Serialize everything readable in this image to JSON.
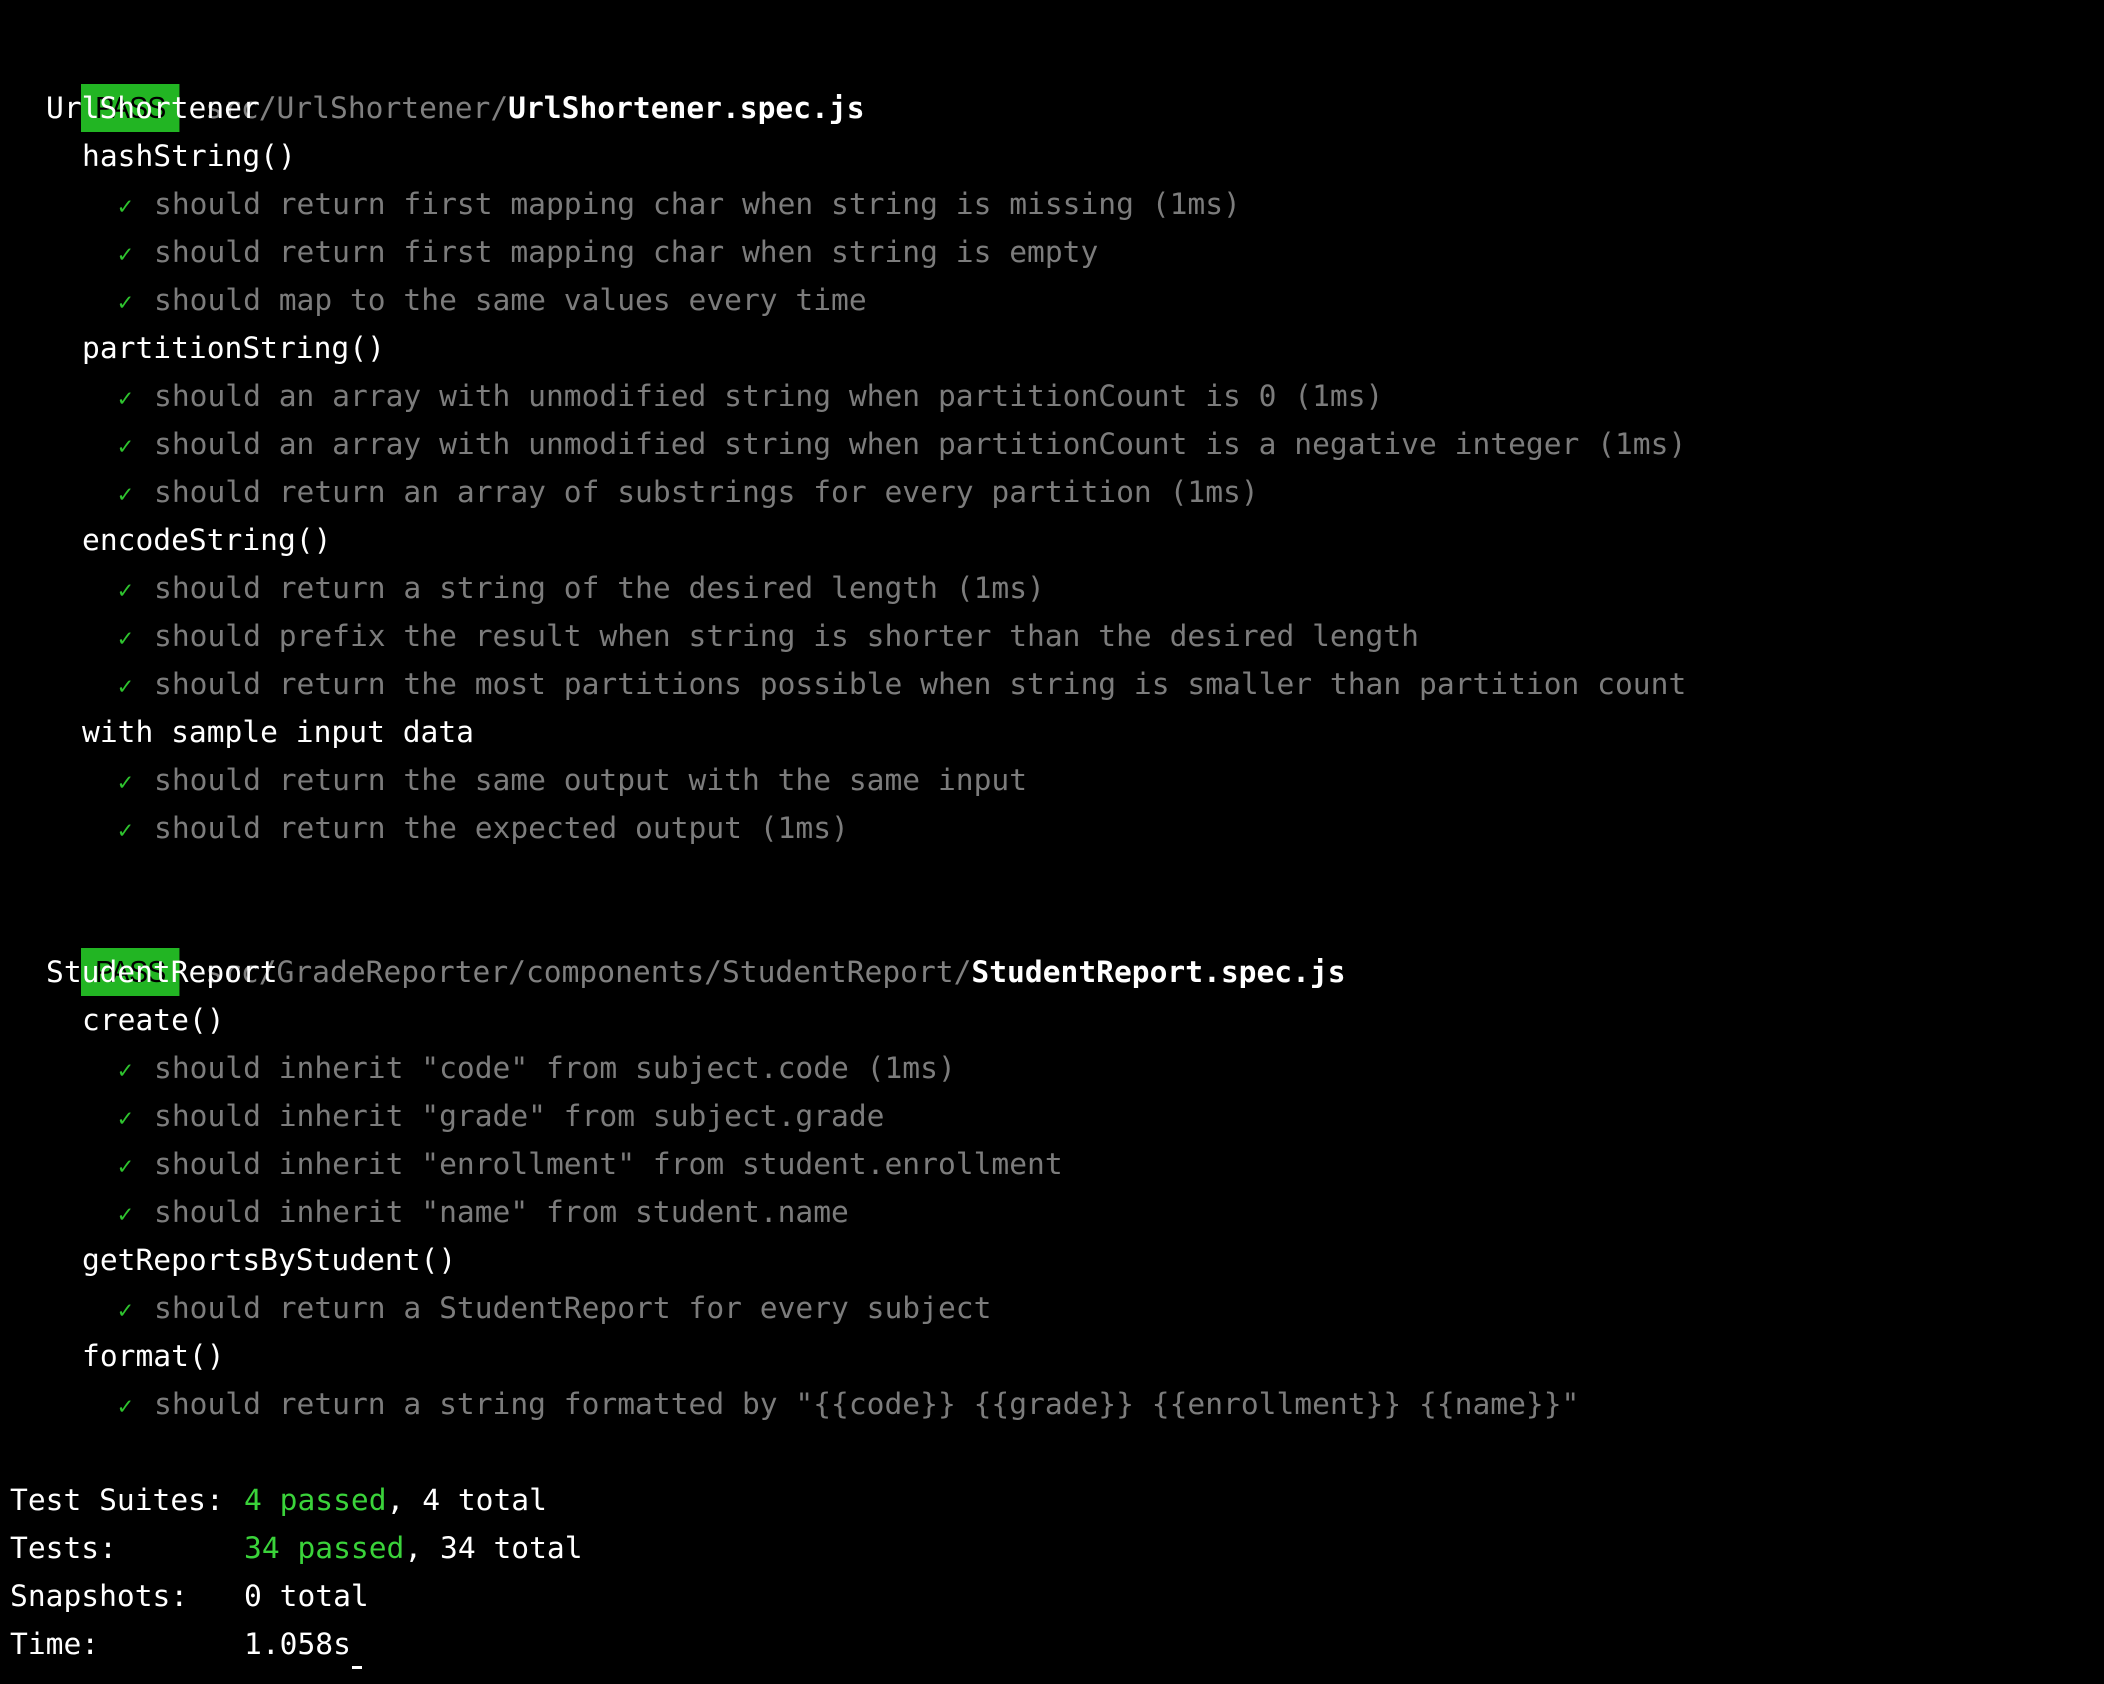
{
  "colors": {
    "background": "#000000",
    "pass_badge": "#22b523",
    "check": "#2ec32e",
    "passed_text": "#3ad33a",
    "path_gray": "#808080",
    "test_gray": "#7c7c7c"
  },
  "suites": [
    {
      "status": "PASS",
      "path": "src/UrlShortener/",
      "file": "UrlShortener.spec.js",
      "describe": "UrlShortener",
      "groups": [
        {
          "name": "hashString()",
          "tests": [
            {
              "icon": "check-icon",
              "glyph": "✓",
              "title": "should return first mapping char when string is missing (1ms)"
            },
            {
              "icon": "check-icon",
              "glyph": "✓",
              "title": "should return first mapping char when string is empty"
            },
            {
              "icon": "check-icon",
              "glyph": "✓",
              "title": "should map to the same values every time"
            }
          ]
        },
        {
          "name": "partitionString()",
          "tests": [
            {
              "icon": "check-icon",
              "glyph": "✓",
              "title": "should an array with unmodified string when partitionCount is 0 (1ms)"
            },
            {
              "icon": "check-icon",
              "glyph": "✓",
              "title": "should an array with unmodified string when partitionCount is a negative integer (1ms)"
            },
            {
              "icon": "check-icon",
              "glyph": "✓",
              "title": "should return an array of substrings for every partition (1ms)"
            }
          ]
        },
        {
          "name": "encodeString()",
          "tests": [
            {
              "icon": "check-icon",
              "glyph": "✓",
              "title": "should return a string of the desired length (1ms)"
            },
            {
              "icon": "check-icon",
              "glyph": "✓",
              "title": "should prefix the result when string is shorter than the desired length"
            },
            {
              "icon": "check-icon",
              "glyph": "✓",
              "title": "should return the most partitions possible when string is smaller than partition count"
            }
          ]
        },
        {
          "name": "with sample input data",
          "tests": [
            {
              "icon": "check-icon",
              "glyph": "✓",
              "title": "should return the same output with the same input"
            },
            {
              "icon": "check-icon",
              "glyph": "✓",
              "title": "should return the expected output (1ms)"
            }
          ]
        }
      ]
    },
    {
      "status": "PASS",
      "path": "src/GradeReporter/components/StudentReport/",
      "file": "StudentReport.spec.js",
      "describe": "StudentReport",
      "groups": [
        {
          "name": "create()",
          "tests": [
            {
              "icon": "check-icon",
              "glyph": "✓",
              "title": "should inherit \"code\" from subject.code (1ms)"
            },
            {
              "icon": "check-icon",
              "glyph": "✓",
              "title": "should inherit \"grade\" from subject.grade"
            },
            {
              "icon": "check-icon",
              "glyph": "✓",
              "title": "should inherit \"enrollment\" from student.enrollment"
            },
            {
              "icon": "check-icon",
              "glyph": "✓",
              "title": "should inherit \"name\" from student.name"
            }
          ]
        },
        {
          "name": "getReportsByStudent()",
          "tests": [
            {
              "icon": "check-icon",
              "glyph": "✓",
              "title": "should return a StudentReport for every subject"
            }
          ]
        },
        {
          "name": "format()",
          "tests": [
            {
              "icon": "check-icon",
              "glyph": "✓",
              "title": "should return a string formatted by \"{{code}} {{grade}} {{enrollment}} {{name}}\""
            }
          ]
        }
      ]
    }
  ],
  "summary": {
    "test_suites": {
      "label": "Test Suites:",
      "passed": "4 passed",
      "sep": ", ",
      "total": "4 total"
    },
    "tests": {
      "label": "Tests:",
      "passed": "34 passed",
      "sep": ", ",
      "total": "34 total"
    },
    "snapshots": {
      "label": "Snapshots:",
      "total": "0 total"
    },
    "time": {
      "label": "Time:",
      "value": "1.058s"
    }
  }
}
